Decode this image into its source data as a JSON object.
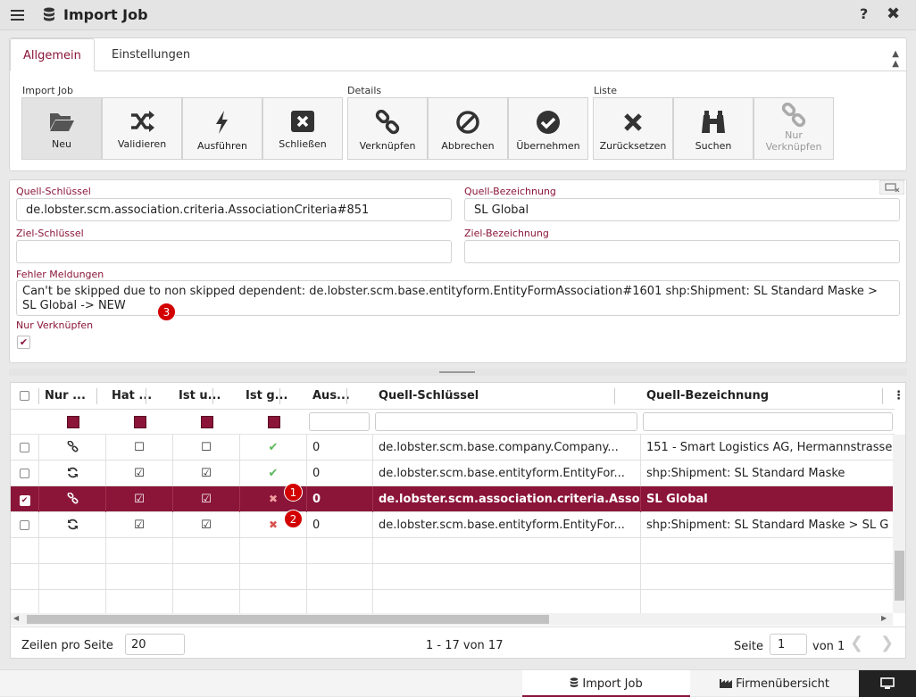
{
  "window": {
    "title": "Import Job",
    "help": "?",
    "close": "✖"
  },
  "tabs": [
    {
      "label": "Allgemein"
    },
    {
      "label": "Einstellungen"
    }
  ],
  "toolbar": {
    "groups": [
      "Import Job",
      "Details",
      "Liste"
    ],
    "buttons": [
      {
        "label": "Neu",
        "icon": "folder-open-icon"
      },
      {
        "label": "Validieren",
        "icon": "shuffle-icon"
      },
      {
        "label": "Ausführen",
        "icon": "bolt-icon"
      },
      {
        "label": "Schließen",
        "icon": "close-box-icon"
      },
      {
        "label": "Verknüpfen",
        "icon": "link-icon"
      },
      {
        "label": "Abbrechen",
        "icon": "ban-icon"
      },
      {
        "label": "Übernehmen",
        "icon": "check-circle-icon"
      },
      {
        "label": "Zurücksetzen",
        "icon": "times-icon"
      },
      {
        "label": "Suchen",
        "icon": "binoculars-icon"
      },
      {
        "label": "Nur",
        "label2": "Verknüpfen",
        "icon": "link-icon"
      }
    ]
  },
  "form": {
    "quell_schluessel_label": "Quell-Schlüssel",
    "quell_schluessel": "de.lobster.scm.association.criteria.AssociationCriteria#851",
    "quell_bezeichnung_label": "Quell-Bezeichnung",
    "quell_bezeichnung": "SL Global",
    "ziel_schluessel_label": "Ziel-Schlüssel",
    "ziel_schluessel": "",
    "ziel_bezeichnung_label": "Ziel-Bezeichnung",
    "ziel_bezeichnung": "",
    "fehler_label": "Fehler Meldungen",
    "fehler": "Can't be skipped due to non skipped dependent: de.lobster.scm.base.entityform.EntityFormAssociation#1601 shp:Shipment: SL Standard Maske > SL Global -> NEW",
    "nur_verknuepfen_label": "Nur Verknüpfen",
    "nur_verknuepfen": "✔"
  },
  "grid": {
    "columns": [
      "Nur ...",
      "Hat ...",
      "Ist u...",
      "Ist g...",
      "Aus...",
      "Quell-Schlüssel",
      "Quell-Bezeichnung"
    ],
    "menu": "⋮",
    "rows": [
      {
        "sel": "",
        "nur": "link",
        "hat": "☐",
        "istu": "☐",
        "istg": "✔",
        "aus": "0",
        "key": "de.lobster.scm.base.company.Company...",
        "bez": "151 - Smart Logistics AG, Hermannstrasse"
      },
      {
        "sel": "",
        "nur": "refresh",
        "hat": "☑",
        "istu": "☑",
        "istg": "✔",
        "aus": "0",
        "key": "de.lobster.scm.base.entityform.EntityFor...",
        "bez": "shp:Shipment: SL Standard Maske"
      },
      {
        "sel": "✔",
        "nur": "link",
        "hat": "☑",
        "istu": "☑",
        "istg": "✖",
        "aus": "0",
        "key": "de.lobster.scm.association.criteria.Assoc...",
        "bez": "SL Global"
      },
      {
        "sel": "",
        "nur": "refresh",
        "hat": "☑",
        "istu": "☑",
        "istg": "✖",
        "aus": "0",
        "key": "de.lobster.scm.base.entityform.EntityFor...",
        "bez": "shp:Shipment: SL Standard Maske > SL G"
      }
    ],
    "footer": {
      "rows_label": "Zeilen pro Seite",
      "rows_value": "20",
      "range": "1 - 17 von 17",
      "page_label": "Seite",
      "page_value": "1",
      "of_label": "von 1"
    }
  },
  "badges": [
    "1",
    "2",
    "3"
  ],
  "bottom_tabs": [
    {
      "label": "Import Job",
      "icon": "database-icon"
    },
    {
      "label": "Firmenübersicht",
      "icon": "factory-icon"
    }
  ],
  "colors": {
    "accent": "#8a1538",
    "ok": "#5cb85c",
    "error": "#d9534f",
    "badge": "#d30000"
  }
}
